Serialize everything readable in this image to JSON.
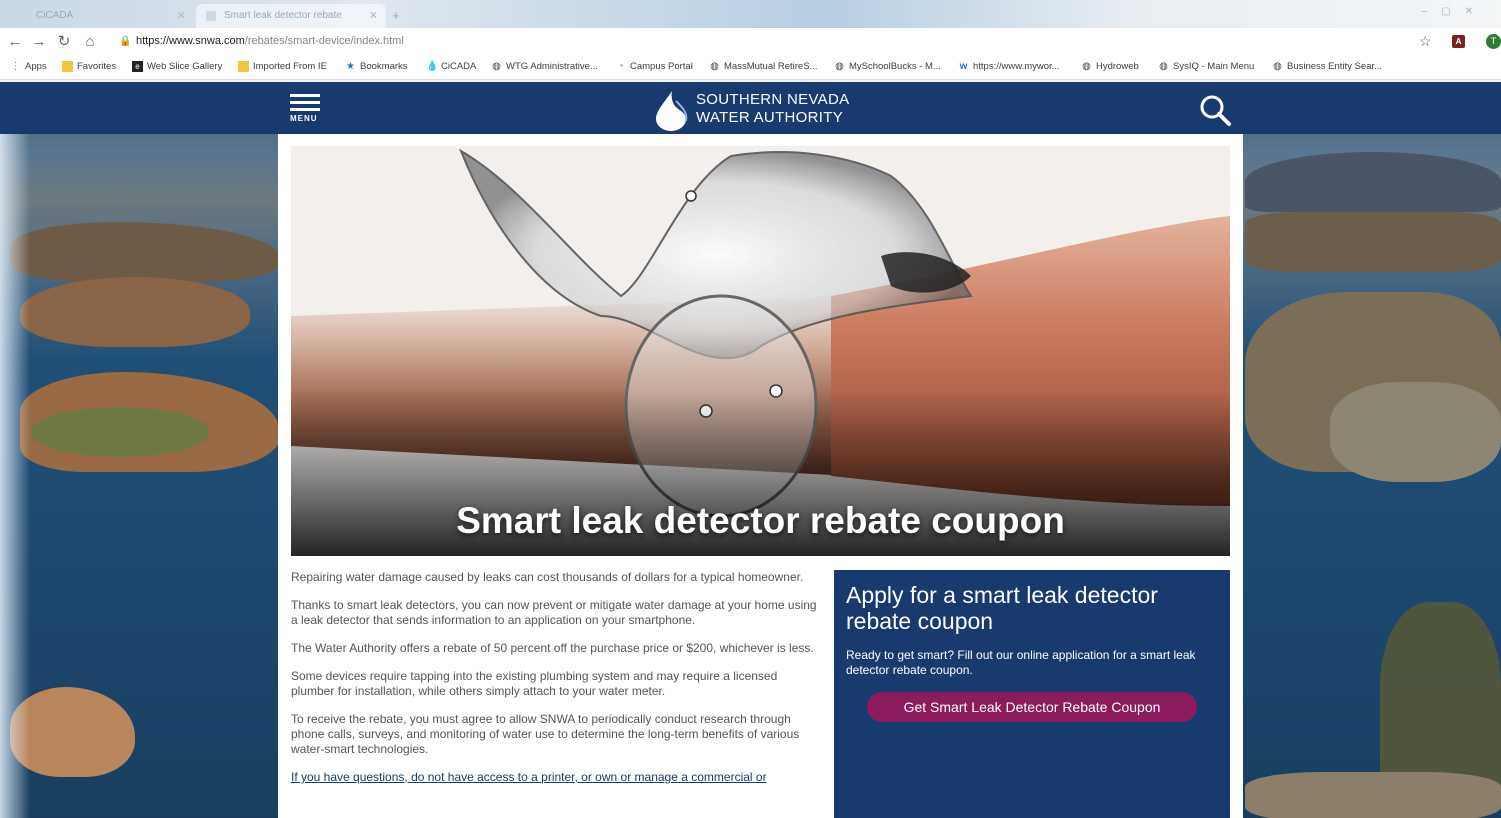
{
  "browser": {
    "tabs": [
      {
        "title": "CiCADA"
      },
      {
        "title": "Smart leak detector rebate"
      }
    ],
    "url_host": "https://www.snwa.com",
    "url_path": "/rebates/smart-device/index.html",
    "profile_initial": "T",
    "bookmarks": [
      {
        "label": "Apps",
        "icon": "apps-grid-icon"
      },
      {
        "label": "Favorites",
        "icon": "folder-icon"
      },
      {
        "label": "Web Slice Gallery",
        "icon": "web-slice-icon"
      },
      {
        "label": "Imported From IE",
        "icon": "folder-icon"
      },
      {
        "label": "Bookmarks",
        "icon": "star-icon"
      },
      {
        "label": "CiCADA",
        "icon": "water-drop-icon"
      },
      {
        "label": "WTG Administrative...",
        "icon": "globe-icon"
      },
      {
        "label": "Campus Portal",
        "icon": "campus-icon"
      },
      {
        "label": "MassMutual RetireS...",
        "icon": "globe-icon"
      },
      {
        "label": "MySchoolBucks - M...",
        "icon": "globe-icon"
      },
      {
        "label": "https://www.mywor...",
        "icon": "w-icon"
      },
      {
        "label": "Hydroweb",
        "icon": "globe-icon"
      },
      {
        "label": "SysIQ - Main Menu",
        "icon": "globe-icon"
      },
      {
        "label": "Business Entity Sear...",
        "icon": "globe-icon"
      }
    ]
  },
  "site": {
    "menu_label": "MENU",
    "logo_line1": "SOUTHERN NEVADA",
    "logo_line2": "WATER AUTHORITY"
  },
  "hero": {
    "title": "Smart leak detector rebate coupon"
  },
  "body": {
    "paragraphs": [
      "Repairing water damage caused by leaks can cost thousands of dollars for a typical homeowner.",
      "Thanks to smart leak detectors, you can now prevent or mitigate water damage at your home using a leak detector that sends information to an application on your smartphone.",
      "The Water Authority offers a rebate of 50 percent off the purchase price or $200, whichever is less.",
      "Some devices require tapping into the existing plumbing system and may require a licensed plumber for installation, while others simply attach to your water meter.",
      "To receive the rebate, you must agree to allow SNWA to periodically conduct research through phone calls, surveys, and monitoring of water use to determine the long-term benefits of various water-smart technologies.",
      "If you have questions, do not have access to a printer, or own or manage a commercial or"
    ]
  },
  "apply": {
    "heading": "Apply for a smart leak detector rebate coupon",
    "description": "Ready to get smart? Fill out our online application for a smart leak detector rebate coupon.",
    "button_label": "Get Smart Leak Detector Rebate Coupon"
  },
  "colors": {
    "brand_navy": "#173b6e",
    "button_magenta": "#8b1b5a"
  }
}
